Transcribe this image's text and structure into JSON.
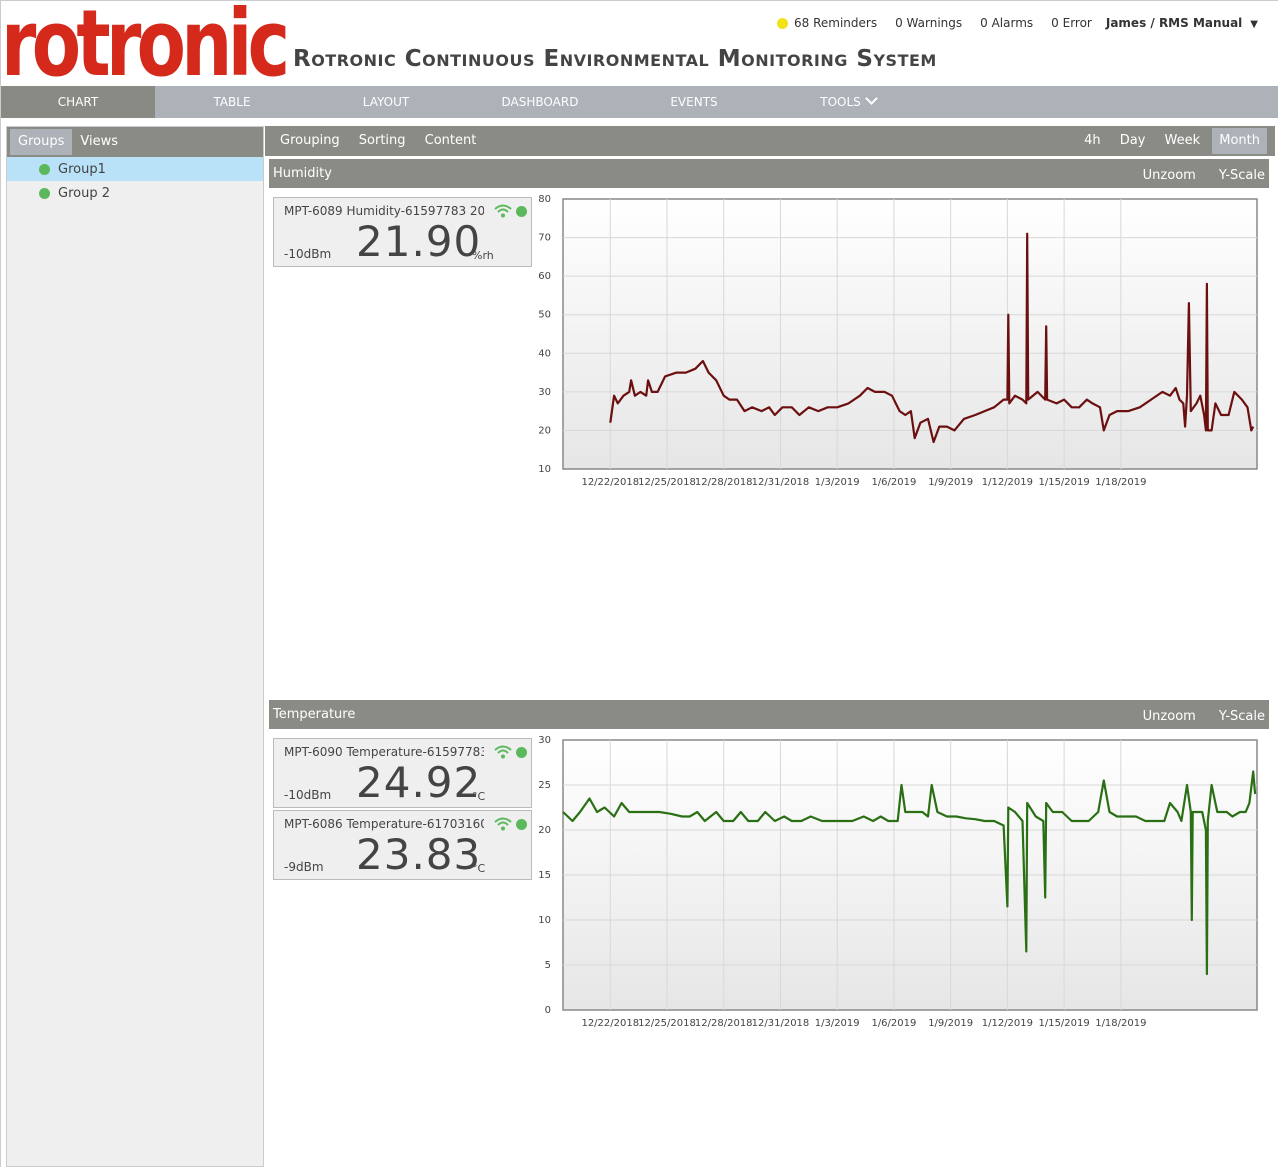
{
  "brand": {
    "logo_text": "rotronic",
    "app_title": "Rotronic Continuous Environmental Monitoring System",
    "logo_color": "#d4291b"
  },
  "status": {
    "reminders": "68 Reminders",
    "warnings": "0 Warnings",
    "alarms": "0 Alarms",
    "errors": "0 Error",
    "user": "James / RMS Manual"
  },
  "nav": {
    "tabs": [
      "CHART",
      "TABLE",
      "LAYOUT",
      "DASHBOARD",
      "EVENTS",
      "TOOLS"
    ],
    "active": "CHART"
  },
  "sidebar": {
    "tabs": [
      "Groups",
      "Views"
    ],
    "active_tab": "Groups",
    "groups": [
      "Group1",
      "Group 2"
    ],
    "selected_group": "Group1"
  },
  "toolbar": {
    "left": [
      "Grouping",
      "Sorting",
      "Content"
    ],
    "ranges": [
      "4h",
      "Day",
      "Week",
      "Month"
    ],
    "active_range": "Month"
  },
  "panel_actions": {
    "unzoom": "Unzoom",
    "yscale": "Y-Scale"
  },
  "panels": [
    {
      "title": "Humidity",
      "sensors": [
        {
          "name": "MPT-6089 Humidity-61597783 20...",
          "signal": "-10dBm",
          "value": "21.90",
          "unit": "%rh"
        }
      ]
    },
    {
      "title": "Temperature",
      "sensors": [
        {
          "name": "MPT-6090 Temperature-61597783...",
          "signal": "-10dBm",
          "value": "24.92",
          "unit": "°C"
        },
        {
          "name": "MPT-6086 Temperature-61703160...",
          "signal": "-9dBm",
          "value": "23.83",
          "unit": "°C"
        }
      ]
    }
  ],
  "chart_data": [
    {
      "type": "line",
      "title": "Humidity",
      "xlabel": "",
      "ylabel": "",
      "ylim": [
        10,
        80
      ],
      "yticks": [
        10,
        20,
        30,
        40,
        50,
        60,
        70,
        80
      ],
      "xticks": [
        "12/22/2018",
        "12/25/2018",
        "12/28/2018",
        "12/31/2018",
        "1/3/2019",
        "1/6/2019",
        "1/9/2019",
        "1/12/2019",
        "1/15/2019",
        "1/18/2019"
      ],
      "grid": true,
      "color": "#6b0f0f",
      "series": [
        {
          "x_days_label": "day",
          "points": [
            [
              0,
              22
            ],
            [
              0.2,
              29
            ],
            [
              0.4,
              27
            ],
            [
              0.7,
              29
            ],
            [
              1.0,
              30
            ],
            [
              1.1,
              33
            ],
            [
              1.3,
              29
            ],
            [
              1.6,
              30
            ],
            [
              1.9,
              29
            ],
            [
              2.0,
              33
            ],
            [
              2.2,
              30
            ],
            [
              2.5,
              30
            ],
            [
              2.9,
              34
            ],
            [
              3.5,
              35
            ],
            [
              4.0,
              35
            ],
            [
              4.5,
              36
            ],
            [
              4.9,
              38
            ],
            [
              5.2,
              35
            ],
            [
              5.6,
              33
            ],
            [
              6.0,
              29
            ],
            [
              6.3,
              28
            ],
            [
              6.7,
              28
            ],
            [
              7.1,
              25
            ],
            [
              7.5,
              26
            ],
            [
              8.0,
              25
            ],
            [
              8.4,
              26
            ],
            [
              8.7,
              24
            ],
            [
              9.1,
              26
            ],
            [
              9.6,
              26
            ],
            [
              10.0,
              24
            ],
            [
              10.5,
              26
            ],
            [
              11.0,
              25
            ],
            [
              11.5,
              26
            ],
            [
              12.0,
              26
            ],
            [
              12.6,
              27
            ],
            [
              13.2,
              29
            ],
            [
              13.6,
              31
            ],
            [
              14.0,
              30
            ],
            [
              14.5,
              30
            ],
            [
              14.9,
              29
            ],
            [
              15.3,
              25
            ],
            [
              15.6,
              24
            ],
            [
              15.9,
              25
            ],
            [
              16.1,
              18
            ],
            [
              16.4,
              22
            ],
            [
              16.8,
              23
            ],
            [
              17.1,
              17
            ],
            [
              17.4,
              21
            ],
            [
              17.8,
              21
            ],
            [
              18.2,
              20
            ],
            [
              18.7,
              23
            ],
            [
              19.3,
              24
            ],
            [
              19.8,
              25
            ],
            [
              20.3,
              26
            ],
            [
              20.8,
              28
            ],
            [
              21.0,
              28
            ],
            [
              21.05,
              50
            ],
            [
              21.1,
              27
            ],
            [
              21.4,
              29
            ],
            [
              21.8,
              28
            ],
            [
              22.0,
              27
            ],
            [
              22.05,
              71
            ],
            [
              22.1,
              28
            ],
            [
              22.6,
              30
            ],
            [
              23.0,
              28
            ],
            [
              23.05,
              47
            ],
            [
              23.1,
              28
            ],
            [
              23.6,
              27
            ],
            [
              24.0,
              28
            ],
            [
              24.4,
              26
            ],
            [
              24.8,
              26
            ],
            [
              25.2,
              28
            ],
            [
              25.5,
              27
            ],
            [
              25.9,
              26
            ],
            [
              26.1,
              20
            ],
            [
              26.4,
              24
            ],
            [
              26.8,
              25
            ],
            [
              27.4,
              25
            ],
            [
              28.0,
              26
            ],
            [
              28.6,
              28
            ],
            [
              29.2,
              30
            ],
            [
              29.6,
              29
            ],
            [
              29.9,
              31
            ],
            [
              30.1,
              28
            ],
            [
              30.3,
              27
            ],
            [
              30.4,
              21
            ],
            [
              30.5,
              29
            ],
            [
              30.6,
              53
            ],
            [
              30.7,
              25
            ],
            [
              31.0,
              27
            ],
            [
              31.2,
              29
            ],
            [
              31.4,
              24
            ],
            [
              31.5,
              20
            ],
            [
              31.55,
              58
            ],
            [
              31.6,
              20
            ],
            [
              31.8,
              20
            ],
            [
              32.0,
              27
            ],
            [
              32.3,
              24
            ],
            [
              32.7,
              24
            ],
            [
              33.0,
              30
            ],
            [
              33.4,
              28
            ],
            [
              33.7,
              26
            ],
            [
              33.9,
              20
            ],
            [
              34.0,
              21
            ]
          ]
        }
      ],
      "x_range_days": [
        -2.5,
        34.2
      ]
    },
    {
      "type": "line",
      "title": "Temperature",
      "xlabel": "",
      "ylabel": "",
      "ylim": [
        0,
        30
      ],
      "yticks": [
        0,
        5,
        10,
        15,
        20,
        25,
        30
      ],
      "xticks": [
        "12/22/2018",
        "12/25/2018",
        "12/28/2018",
        "12/31/2018",
        "1/3/2019",
        "1/6/2019",
        "1/9/2019",
        "1/12/2019",
        "1/15/2019",
        "1/18/2019"
      ],
      "grid": true,
      "color": "#2a6f14",
      "series": [
        {
          "points": [
            [
              -2.5,
              22
            ],
            [
              -2.0,
              21
            ],
            [
              -1.6,
              22
            ],
            [
              -1.1,
              23.5
            ],
            [
              -0.7,
              22
            ],
            [
              -0.3,
              22.5
            ],
            [
              0.2,
              21.5
            ],
            [
              0.6,
              23
            ],
            [
              1.0,
              22
            ],
            [
              1.5,
              22
            ],
            [
              2.0,
              22
            ],
            [
              2.6,
              22
            ],
            [
              3.2,
              21.8
            ],
            [
              3.8,
              21.5
            ],
            [
              4.2,
              21.5
            ],
            [
              4.6,
              22
            ],
            [
              5.0,
              21
            ],
            [
              5.3,
              21.5
            ],
            [
              5.6,
              22
            ],
            [
              6.0,
              21
            ],
            [
              6.5,
              21
            ],
            [
              6.9,
              22
            ],
            [
              7.3,
              21
            ],
            [
              7.8,
              21
            ],
            [
              8.2,
              22
            ],
            [
              8.7,
              21
            ],
            [
              9.2,
              21.5
            ],
            [
              9.6,
              21
            ],
            [
              10.1,
              21
            ],
            [
              10.6,
              21.5
            ],
            [
              11.2,
              21
            ],
            [
              11.7,
              21
            ],
            [
              12.3,
              21
            ],
            [
              12.8,
              21
            ],
            [
              13.4,
              21.5
            ],
            [
              13.9,
              21
            ],
            [
              14.3,
              21.5
            ],
            [
              14.7,
              21
            ],
            [
              15.2,
              21
            ],
            [
              15.4,
              25
            ],
            [
              15.6,
              22
            ],
            [
              16.1,
              22
            ],
            [
              16.5,
              22
            ],
            [
              16.8,
              21.5
            ],
            [
              17.0,
              25
            ],
            [
              17.3,
              22
            ],
            [
              17.8,
              21.5
            ],
            [
              18.3,
              21.5
            ],
            [
              18.8,
              21.3
            ],
            [
              19.3,
              21.2
            ],
            [
              19.8,
              21
            ],
            [
              20.3,
              21
            ],
            [
              20.8,
              20.5
            ],
            [
              21.0,
              11.5
            ],
            [
              21.05,
              22.5
            ],
            [
              21.4,
              22
            ],
            [
              21.8,
              21
            ],
            [
              22.0,
              6.5
            ],
            [
              22.05,
              23
            ],
            [
              22.5,
              21.5
            ],
            [
              22.9,
              21
            ],
            [
              23.0,
              12.5
            ],
            [
              23.05,
              23
            ],
            [
              23.4,
              22
            ],
            [
              23.9,
              22
            ],
            [
              24.4,
              21
            ],
            [
              24.9,
              21
            ],
            [
              25.3,
              21
            ],
            [
              25.8,
              22
            ],
            [
              26.1,
              25.5
            ],
            [
              26.4,
              22
            ],
            [
              26.8,
              21.5
            ],
            [
              27.3,
              21.5
            ],
            [
              27.8,
              21.5
            ],
            [
              28.3,
              21
            ],
            [
              28.8,
              21
            ],
            [
              29.3,
              21
            ],
            [
              29.6,
              23
            ],
            [
              30.0,
              22
            ],
            [
              30.2,
              21
            ],
            [
              30.5,
              25
            ],
            [
              30.7,
              22
            ],
            [
              30.75,
              10
            ],
            [
              30.8,
              22
            ],
            [
              31.3,
              22
            ],
            [
              31.5,
              20
            ],
            [
              31.55,
              4
            ],
            [
              31.6,
              21
            ],
            [
              31.8,
              25
            ],
            [
              32.1,
              22
            ],
            [
              32.6,
              22
            ],
            [
              32.9,
              21.5
            ],
            [
              33.3,
              22
            ],
            [
              33.6,
              22
            ],
            [
              33.8,
              23
            ],
            [
              34.0,
              26.5
            ],
            [
              34.1,
              24
            ]
          ]
        }
      ],
      "x_range_days": [
        -2.5,
        34.2
      ]
    }
  ]
}
